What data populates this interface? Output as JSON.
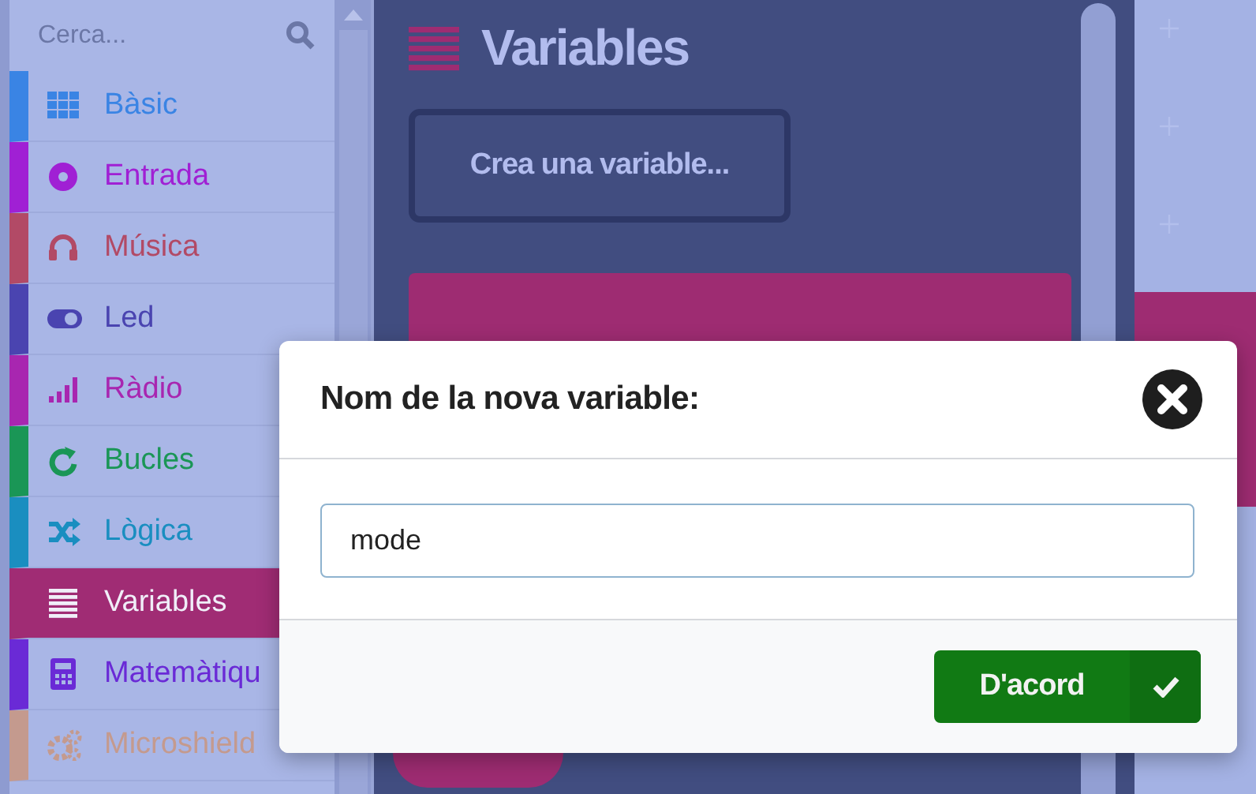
{
  "search": {
    "placeholder": "Cerca..."
  },
  "categories": [
    {
      "label": "Bàsic",
      "color": "#3a84e4",
      "selected": false
    },
    {
      "label": "Entrada",
      "color": "#a020d4",
      "selected": false
    },
    {
      "label": "Música",
      "color": "#b24a66",
      "selected": false
    },
    {
      "label": "Led",
      "color": "#4a44b0",
      "selected": false
    },
    {
      "label": "Ràdio",
      "color": "#a826b0",
      "selected": false
    },
    {
      "label": "Bucles",
      "color": "#1a9656",
      "selected": false
    },
    {
      "label": "Lògica",
      "color": "#1a8ec0",
      "selected": false
    },
    {
      "label": "Variables",
      "color": "#a02c74",
      "selected": true
    },
    {
      "label": "Matemàtiqu",
      "color": "#6a2ad6",
      "selected": false
    },
    {
      "label": "Microshield",
      "color": "#c49a8e",
      "selected": false
    }
  ],
  "flyout": {
    "title": "Variables",
    "create_button": "Crea una variable..."
  },
  "dialog": {
    "title": "Nom de la nova variable:",
    "input_value": "mode",
    "ok_button": "D'acord"
  }
}
